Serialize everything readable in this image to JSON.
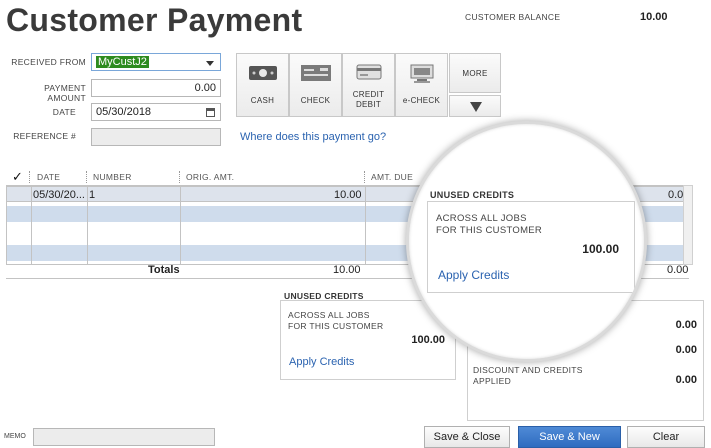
{
  "page": {
    "title": "Customer Payment"
  },
  "customer_balance": {
    "label": "CUSTOMER BALANCE",
    "value": "10.00"
  },
  "form": {
    "received_from": {
      "label": "RECEIVED FROM",
      "value": "MyCustJ2"
    },
    "payment_amount": {
      "label": "PAYMENT AMOUNT",
      "value": "0.00"
    },
    "date": {
      "label": "DATE",
      "value": "05/30/2018"
    },
    "reference": {
      "label": "REFERENCE #",
      "value": ""
    }
  },
  "payment_methods": [
    {
      "label": "CASH",
      "icon": "cash-icon"
    },
    {
      "label": "CHECK",
      "icon": "check-icon"
    },
    {
      "label": "CREDIT DEBIT",
      "icon": "credit-card-icon"
    },
    {
      "label": "e-CHECK",
      "icon": "e-check-icon"
    }
  ],
  "more": {
    "label": "MORE"
  },
  "where_link": "Where does this payment go?",
  "table": {
    "columns": [
      "DATE",
      "NUMBER",
      "ORIG. AMT.",
      "AMT. DUE"
    ],
    "rows": [
      {
        "date": "05/30/20...",
        "number": "1",
        "orig_amt": "10.00",
        "payment": "0.00"
      }
    ],
    "totals": {
      "label": "Totals",
      "orig_amt": "10.00",
      "payment": "0.00"
    }
  },
  "unused_credits": {
    "heading": "UNUSED CREDITS",
    "desc_line1": "ACROSS ALL JOBS",
    "desc_line2": "FOR THIS CUSTOMER",
    "amount": "100.00",
    "link": "Apply Credits"
  },
  "summary": {
    "heading_tail": "ES",
    "amount1": "0.00",
    "amount2": "0.00",
    "discount_label_line1": "DISCOUNT AND CREDITS",
    "discount_label_line2": "APPLIED",
    "discount_amount": "0.00"
  },
  "magnifier": {
    "heading": "UNUSED CREDITS",
    "desc_line1": "ACROSS ALL JOBS",
    "desc_line2": "FOR THIS CUSTOMER",
    "amount": "100.00",
    "link": "Apply Credits"
  },
  "memo": {
    "label": "MEMO",
    "value": ""
  },
  "buttons": {
    "save_close": "Save & Close",
    "save_new": "Save & New",
    "clear": "Clear"
  }
}
